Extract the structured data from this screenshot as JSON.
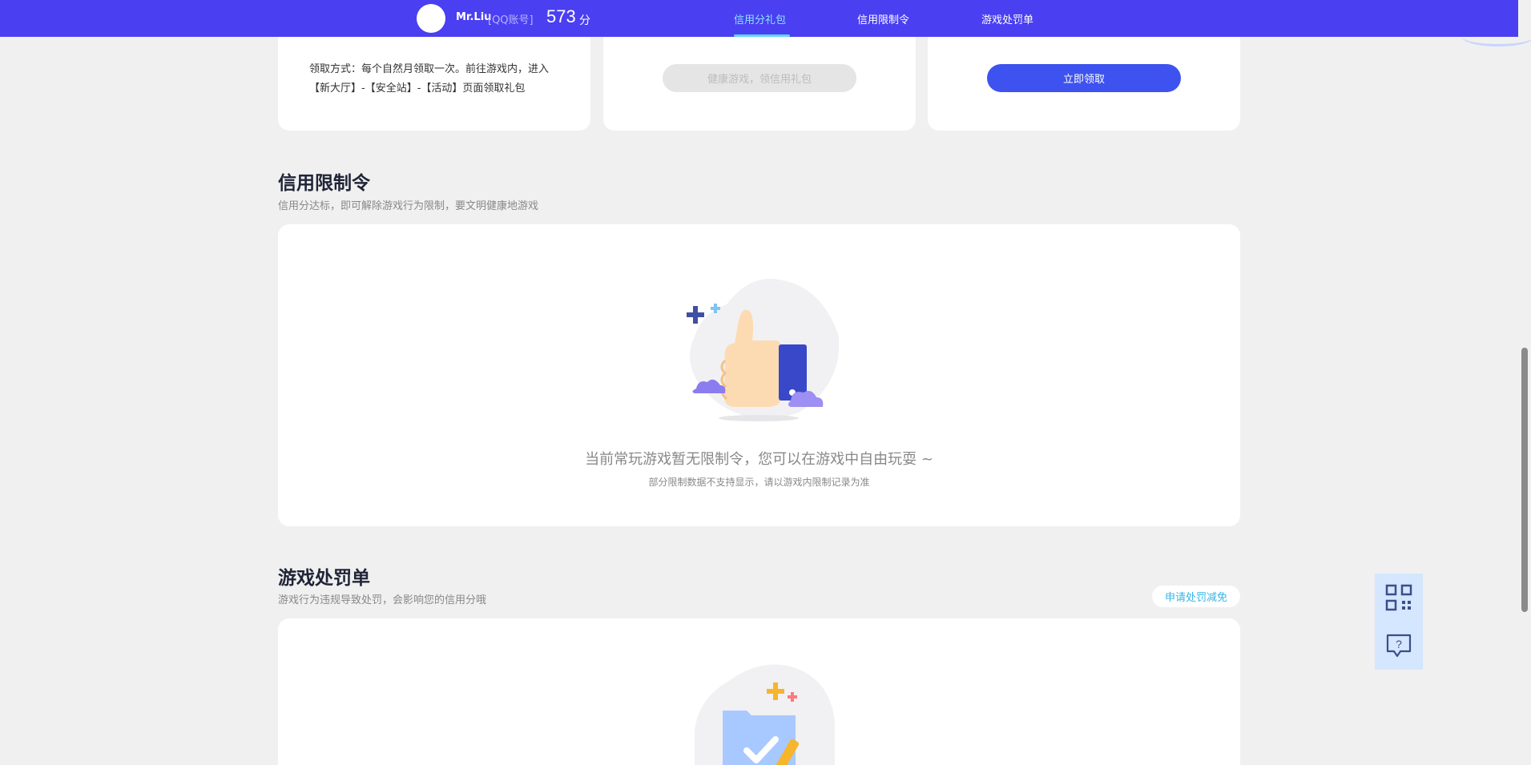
{
  "header": {
    "username": "Mr.Liu",
    "account_type": "[QQ账号]",
    "score": "573",
    "score_unit": "分",
    "tabs": [
      {
        "label": "信用分礼包",
        "active": true
      },
      {
        "label": "信用限制令",
        "active": false
      },
      {
        "label": "游戏处罚单",
        "active": false
      }
    ]
  },
  "gift_cards": {
    "card1_description": "领取方式：每个自然月领取一次。前往游戏内，进入【新大厅】-【安全站】-【活动】页面领取礼包",
    "card2_button": "健康游戏，领信用礼包",
    "card3_button": "立即领取"
  },
  "restriction_section": {
    "title": "信用限制令",
    "subtitle": "信用分达标，即可解除游戏行为限制，要文明健康地游戏",
    "empty_message": "当前常玩游戏暂无限制令，您可以在游戏中自由玩耍 ~",
    "empty_note": "部分限制数据不支持显示，请以游戏内限制记录为准"
  },
  "penalty_section": {
    "title": "游戏处罚单",
    "subtitle": "游戏行为违规导致处罚，会影响您的信用分哦",
    "appeal_button": "申请处罚减免"
  },
  "colors": {
    "topbar": "#4a3ff1",
    "active_tab": "#8de3ff",
    "primary_button": "#3d52ee",
    "appeal_text": "#35b5e6"
  },
  "icons": {
    "empty_restriction": "thumbs-up-illustration",
    "empty_penalty": "folder-check-illustration",
    "float_1": "qr-code-icon",
    "float_2": "help-chat-icon"
  }
}
